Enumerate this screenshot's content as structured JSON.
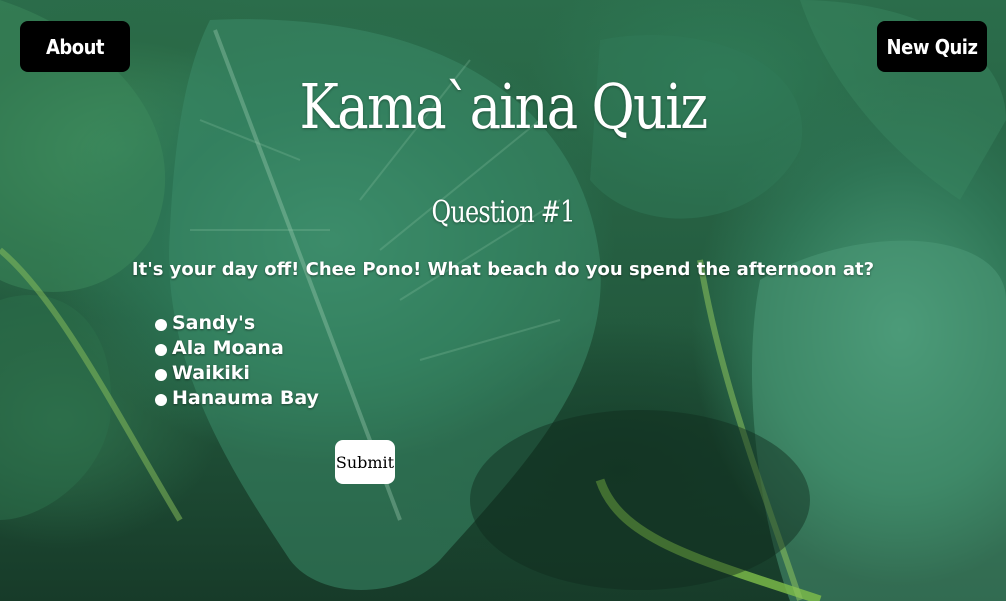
{
  "nav": {
    "about_label": "About",
    "new_quiz_label": "New Quiz"
  },
  "page": {
    "title": "Kama`aina Quiz",
    "question_heading": "Question #1",
    "question_text": "It's your day off! Chee Pono! What beach do you spend the afternoon at?"
  },
  "options": [
    {
      "label": "Sandy's"
    },
    {
      "label": "Ala Moana"
    },
    {
      "label": "Waikiki"
    },
    {
      "label": "Hanauma Bay"
    }
  ],
  "form": {
    "submit_label": "Submit"
  },
  "colors": {
    "button_bg": "#000000",
    "text": "#ffffff",
    "submit_bg": "#ffffff",
    "foliage": "#2c7454"
  }
}
